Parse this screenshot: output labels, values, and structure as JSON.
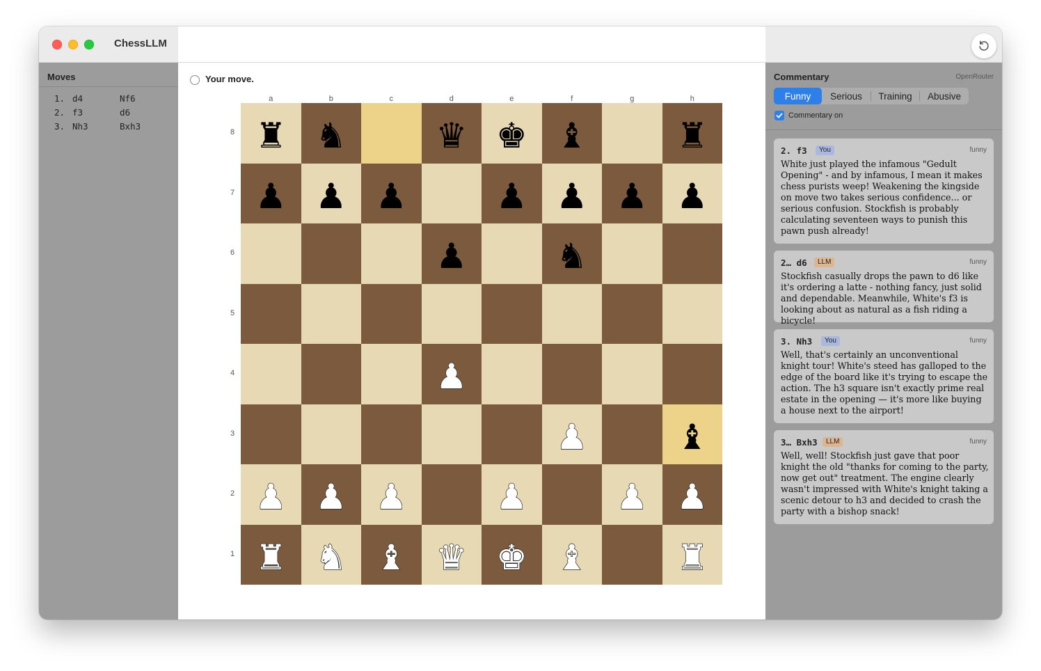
{
  "app": {
    "title": "ChessLLM"
  },
  "moves": {
    "title": "Moves",
    "rows": [
      {
        "num": "1.",
        "white": "d4",
        "black": "Nf6"
      },
      {
        "num": "2.",
        "white": "f3",
        "black": "d6"
      },
      {
        "num": "3.",
        "white": "Nh3",
        "black": "Bxh3"
      }
    ]
  },
  "board_area": {
    "status": "Your move.",
    "files": [
      "a",
      "b",
      "c",
      "d",
      "e",
      "f",
      "g",
      "h"
    ],
    "ranks": [
      "8",
      "7",
      "6",
      "5",
      "4",
      "3",
      "2",
      "1"
    ],
    "highlighted_squares": [
      "c8",
      "h3"
    ],
    "position": {
      "8": [
        "br",
        "bn",
        "",
        "bq",
        "bk",
        "bb",
        "",
        "br"
      ],
      "7": [
        "bp",
        "bp",
        "bp",
        "",
        "bp",
        "bp",
        "bp",
        "bp"
      ],
      "6": [
        "",
        "",
        "",
        "bp",
        "",
        "bn",
        "",
        ""
      ],
      "5": [
        "",
        "",
        "",
        "",
        "",
        "",
        "",
        ""
      ],
      "4": [
        "",
        "",
        "",
        "wp",
        "",
        "",
        "",
        ""
      ],
      "3": [
        "",
        "",
        "",
        "",
        "",
        "wp",
        "",
        "bb"
      ],
      "2": [
        "wp",
        "wp",
        "wp",
        "",
        "wp",
        "",
        "wp",
        "wp"
      ],
      "1": [
        "wr",
        "wn",
        "wb",
        "wq",
        "wk",
        "wb",
        "",
        "wr"
      ]
    }
  },
  "commentary": {
    "title": "Commentary",
    "provider": "OpenRouter",
    "tabs": [
      "Funny",
      "Serious",
      "Training",
      "Abusive"
    ],
    "active_tab": "Funny",
    "toggle_label": "Commentary on",
    "cards": [
      {
        "move": "2. f3",
        "badge": "You",
        "tone": "funny",
        "text": "White just played the infamous \"Gedult Opening\" - and by infamous, I mean it makes chess purists weep! Weakening the kingside on move two takes serious confidence... or serious confusion. Stockfish is probably calculating seventeen ways to punish this pawn push already!"
      },
      {
        "move": "2… d6",
        "badge": "LLM",
        "tone": "funny",
        "text": "Stockfish casually drops the pawn to d6 like it's ordering a latte - nothing fancy, just solid and dependable. Meanwhile, White's f3 is looking about as natural as a fish riding a bicycle!"
      },
      {
        "move": "3. Nh3",
        "badge": "You",
        "tone": "funny",
        "text": "Well, that's certainly an unconventional knight tour! White's steed has galloped to the edge of the board like it's trying to escape the action. The h3 square isn't exactly prime real estate in the opening — it's more like buying a house next to the airport!"
      },
      {
        "move": "3… Bxh3",
        "badge": "LLM",
        "tone": "funny",
        "text": "Well, well! Stockfish just gave that poor knight the old \"thanks for coming to the party, now get out\" treatment. The engine clearly wasn't impressed with White's knight taking a scenic detour to h3 and decided to crash the party with a bishop snack!"
      }
    ]
  }
}
